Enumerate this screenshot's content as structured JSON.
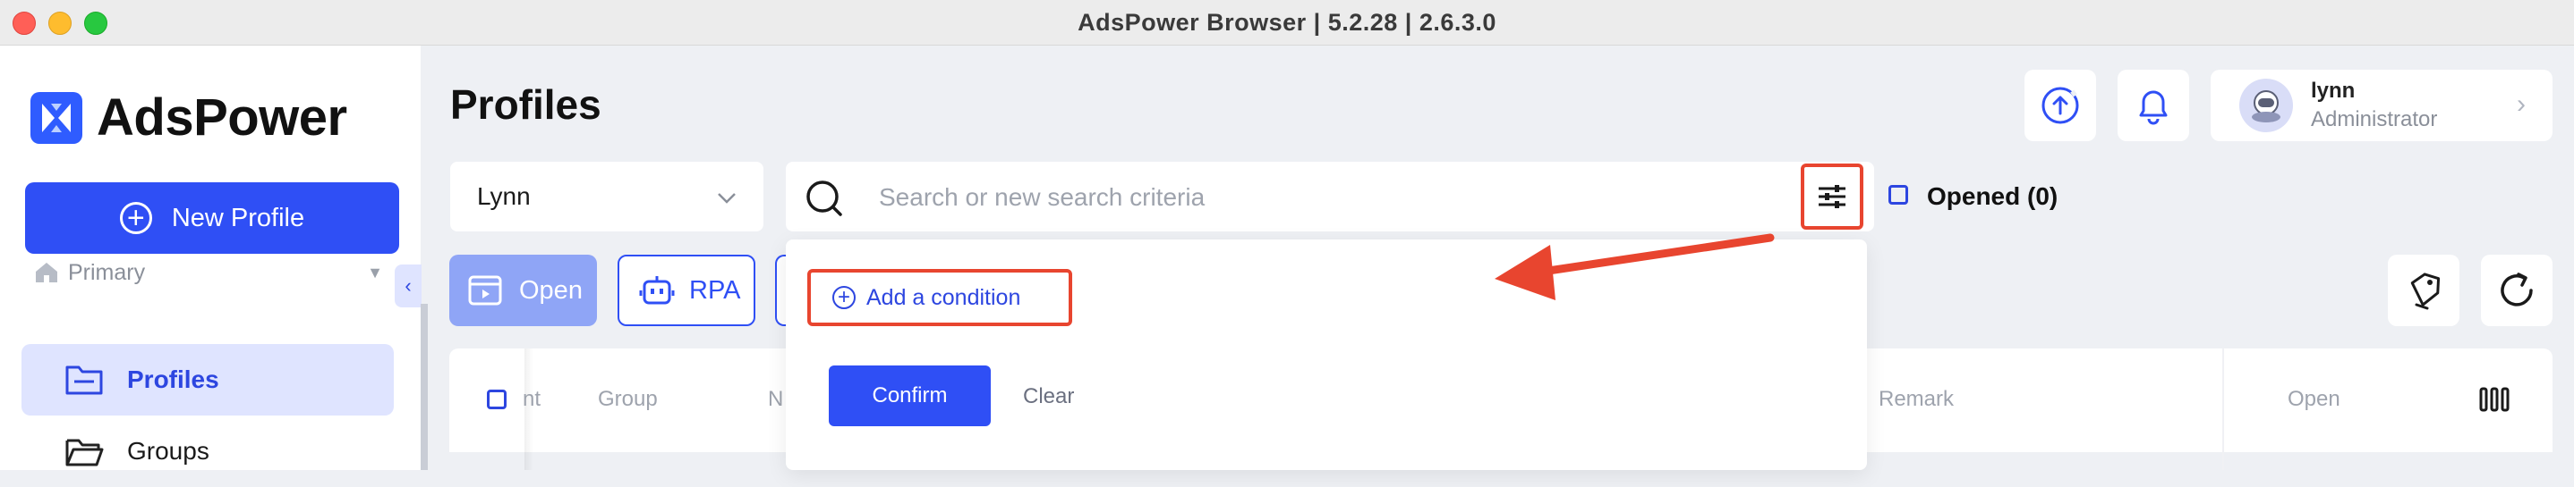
{
  "window": {
    "title": "AdsPower Browser | 5.2.28 | 2.6.3.0"
  },
  "sidebar": {
    "brand": "AdsPower",
    "new_profile": "New Profile",
    "section": "Primary",
    "items": [
      {
        "label": "Profiles",
        "active": true
      },
      {
        "label": "Groups",
        "active": false
      }
    ]
  },
  "header": {
    "title": "Profiles",
    "user": {
      "name": "lynn",
      "role": "Administrator"
    }
  },
  "filters": {
    "group_value": "Lynn",
    "search_placeholder": "Search or new search criteria",
    "opened_label": "Opened (0)"
  },
  "toolbar": {
    "open_label": "Open",
    "rpa_label": "RPA"
  },
  "table": {
    "columns": [
      "nt",
      "Group",
      "N",
      "Remark",
      "Open"
    ]
  },
  "popover": {
    "add_condition": "Add a condition",
    "confirm": "Confirm",
    "clear": "Clear"
  },
  "colors": {
    "accent": "#2f4ff5",
    "highlight": "#e8452f",
    "active_bg": "#dfe4ff"
  }
}
